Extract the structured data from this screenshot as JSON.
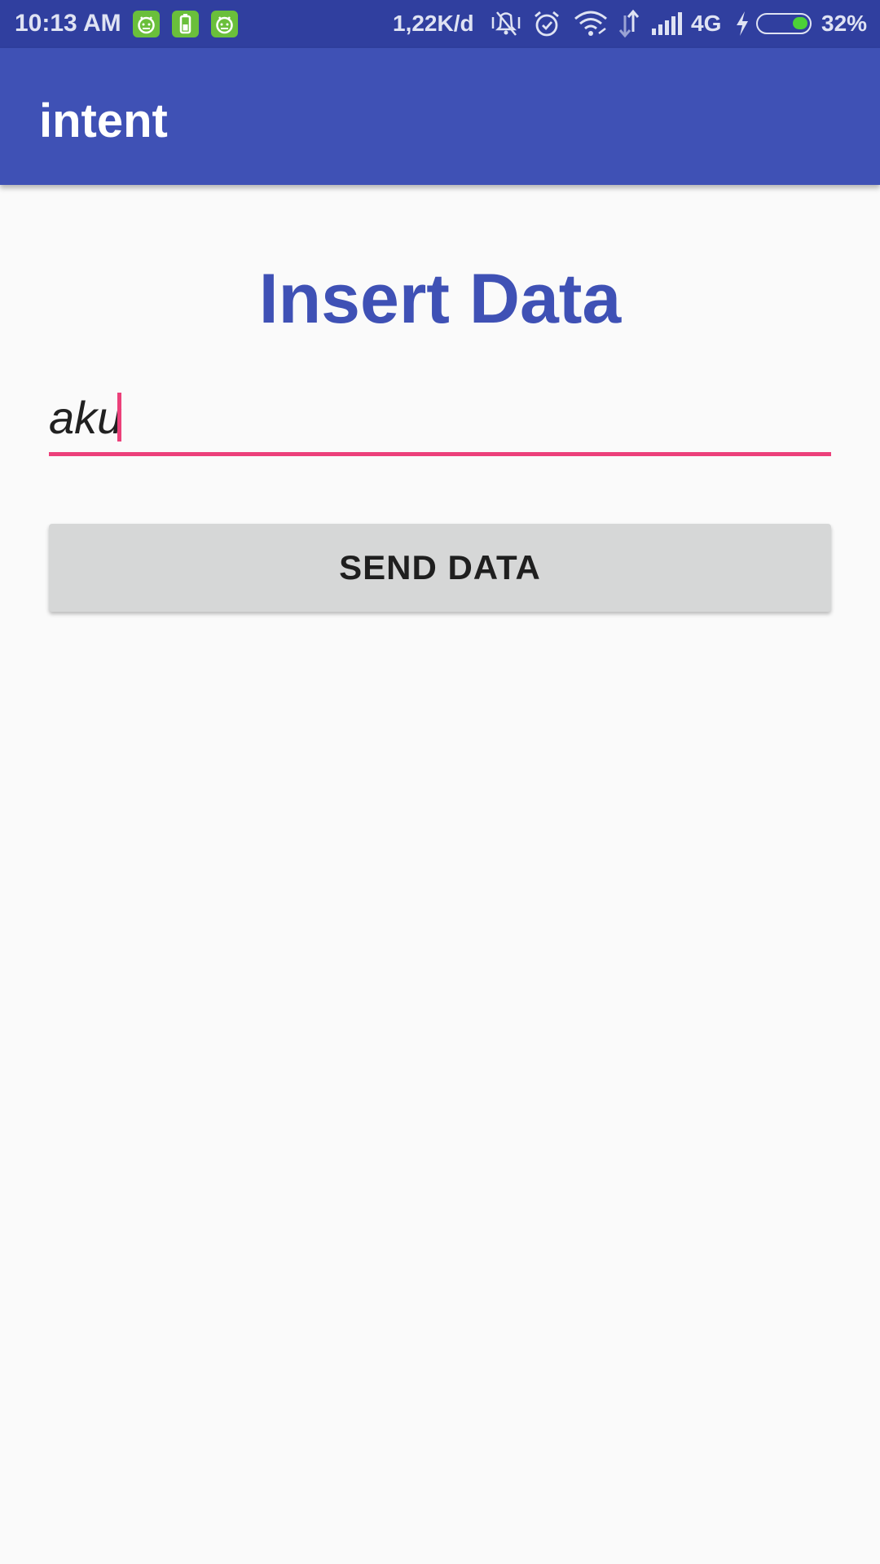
{
  "status_bar": {
    "time": "10:13 AM",
    "network_speed": "1,22K/d",
    "network_type": "4G",
    "battery_percent": "32%",
    "battery_level": 0.32,
    "icons": [
      "android-notification-icon",
      "battery-app-icon",
      "android-notification-icon",
      "vibrate-off-icon",
      "alarm-icon",
      "wifi-icon",
      "data-transfer-icon",
      "signal-icon",
      "charging-icon",
      "battery-icon"
    ]
  },
  "app_bar": {
    "title": "intent"
  },
  "main": {
    "heading": "Insert Data",
    "input": {
      "value": "aku",
      "placeholder": ""
    },
    "send_button_label": "SEND DATA"
  },
  "colors": {
    "status_bar": "#303f9f",
    "primary": "#3f51b5",
    "accent": "#ec407a",
    "button_bg": "#d6d7d7",
    "background": "#fafafa"
  }
}
